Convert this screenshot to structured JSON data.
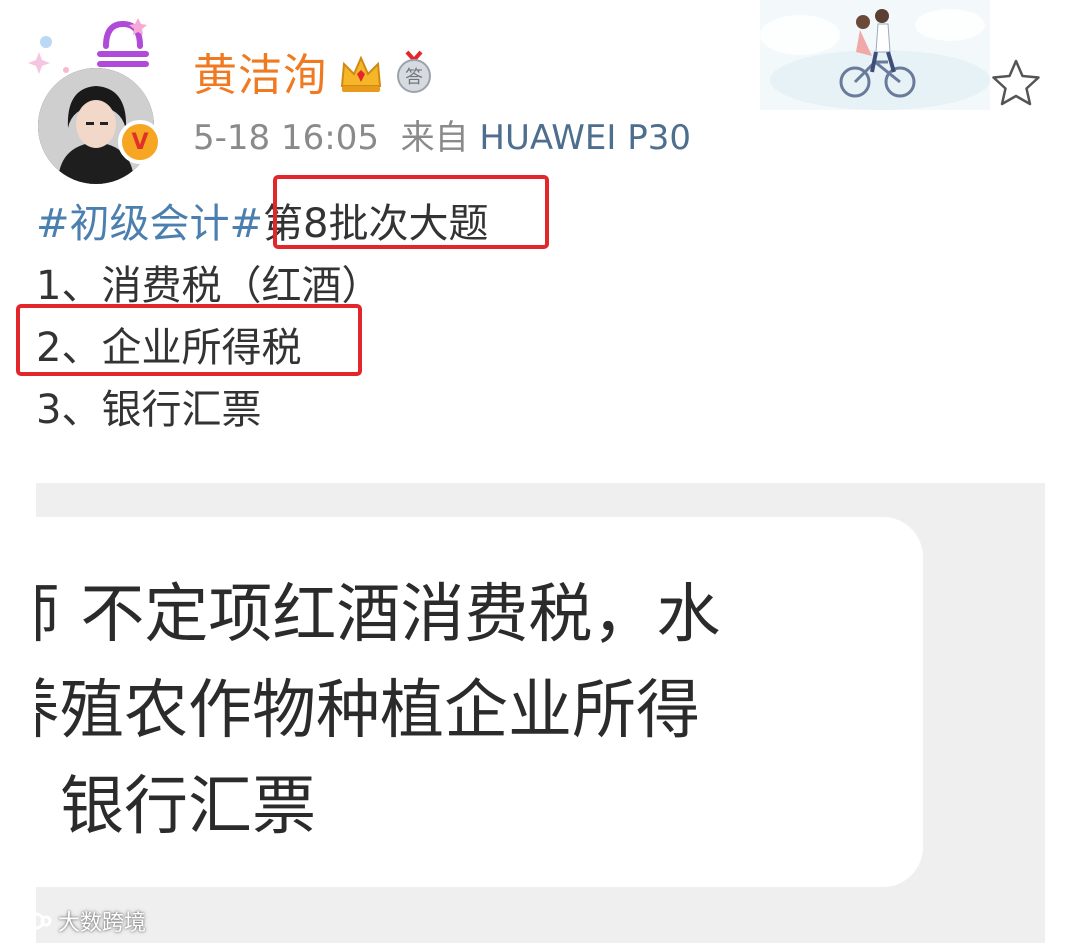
{
  "user": {
    "name": "黄洁洵",
    "timestamp": "5-18 16:05",
    "source_prefix": "来自",
    "source_device": "HUAWEI P30"
  },
  "post": {
    "hashtag": "#初级会计#",
    "title": "第8批次大题",
    "lines": [
      "1、消费税（红酒）",
      "2、企业所得税",
      "3、银行汇票"
    ]
  },
  "embedded_image": {
    "lines": [
      "师 不定项红酒消费税，水",
      "养殖农作物种植企业所得",
      "、银行汇票"
    ]
  },
  "watermark": "大数跨境",
  "colors": {
    "username": "#ef7a22",
    "hashtag": "#4a7fb0",
    "highlight_box": "#e3262b",
    "meta": "#8a8a8a"
  },
  "icons": [
    "zodiac-libra-icon",
    "vip-crown-icon",
    "answer-badge-icon",
    "verified-v-icon",
    "favorite-star-icon"
  ]
}
